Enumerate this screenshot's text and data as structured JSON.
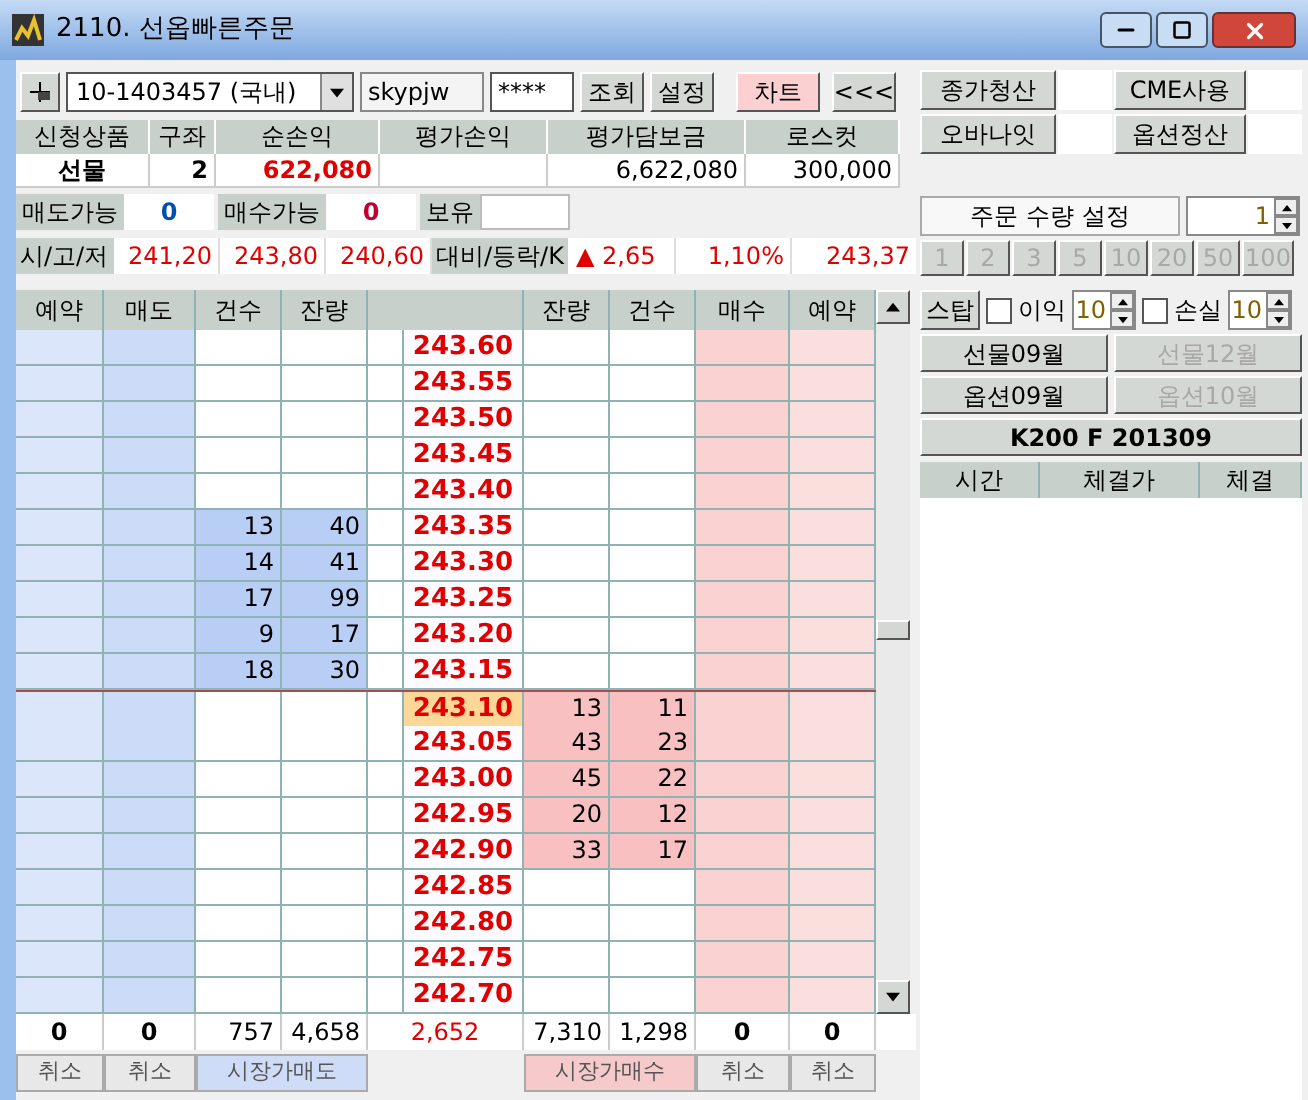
{
  "window": {
    "title": "2110. 선옵빠른주문"
  },
  "toolbar": {
    "account": "10-1403457 (국내)",
    "user_id": "skypjw",
    "password": "****",
    "buttons": [
      "조회",
      "설정"
    ],
    "chart_button": "차트",
    "collapse_button": "<<<"
  },
  "right_buttons": [
    {
      "label": "종가청산"
    },
    {
      "label": "CME사용"
    },
    {
      "label": "오바나잇"
    },
    {
      "label": "옵션정산"
    }
  ],
  "summary": [
    {
      "header": "신청상품",
      "value": "선물"
    },
    {
      "header": "구좌",
      "value": "2"
    },
    {
      "header": "순손익",
      "value": "622,080"
    },
    {
      "header": "평가손익"
    },
    {
      "header": "평가담보금",
      "value": "6,622,080"
    },
    {
      "header": "로스컷",
      "value": "300,000"
    }
  ],
  "availability": [
    {
      "label": "매도가능",
      "value": "0",
      "kind": "sell"
    },
    {
      "label": "매수가능",
      "value": "0",
      "kind": "buy"
    },
    {
      "label": "보유"
    }
  ],
  "quote": {
    "label": "시/고/저",
    "open": "241,20",
    "high": "243,80",
    "low": "240,60",
    "change_label": "대비/등락/K",
    "change": "▲ 2,65",
    "rate": "1,10%",
    "k": "243,37"
  },
  "order_qty": {
    "label": "주문 수량 설정",
    "value": "1",
    "presets": [
      {
        "label": "1",
        "disabled": true
      },
      {
        "label": "2",
        "disabled": true
      },
      {
        "label": "3",
        "disabled": true
      },
      {
        "label": "5",
        "disabled": true
      },
      {
        "label": "10",
        "disabled": true
      },
      {
        "label": "20",
        "disabled": true
      },
      {
        "label": "50",
        "disabled": true
      },
      {
        "label": "100",
        "disabled": true
      }
    ]
  },
  "stop": {
    "button": "스탑",
    "profit": {
      "label": "이익",
      "checked": false,
      "value": "10"
    },
    "loss": {
      "label": "손실",
      "checked": false,
      "value": "10"
    }
  },
  "contracts": [
    {
      "label": "선물09월",
      "disabled": false
    },
    {
      "label": "선물12월",
      "disabled": true
    },
    {
      "label": "옵션09월",
      "disabled": false
    },
    {
      "label": "옵션10월",
      "disabled": true
    }
  ],
  "symbol": "K200 F 201309",
  "trades": {
    "columns": [
      "시간",
      "체결가",
      "체결"
    ]
  },
  "orderbook": {
    "left_columns": [
      "예약",
      "매도",
      "건수",
      "잔량"
    ],
    "right_columns": [
      "잔량",
      "건수",
      "매수",
      "예약"
    ],
    "rows": [
      {
        "kind": "ask",
        "price": "243.60",
        "current": false
      },
      {
        "kind": "ask",
        "price": "243.55",
        "current": false
      },
      {
        "kind": "ask",
        "price": "243.50",
        "current": false
      },
      {
        "kind": "ask",
        "price": "243.45",
        "current": false
      },
      {
        "kind": "ask",
        "price": "243.40",
        "current": false
      },
      {
        "kind": "ask",
        "price": "243.35",
        "count": "13",
        "qty": "40",
        "current": false
      },
      {
        "kind": "ask",
        "price": "243.30",
        "count": "14",
        "qty": "41",
        "current": false
      },
      {
        "kind": "ask",
        "price": "243.25",
        "count": "17",
        "qty": "99",
        "current": false
      },
      {
        "kind": "ask",
        "price": "243.20",
        "count": "9",
        "qty": "17",
        "current": false
      },
      {
        "kind": "ask",
        "price": "243.15",
        "count": "18",
        "qty": "30",
        "current": false
      },
      {
        "kind": "bid",
        "price": "243.10",
        "qty": "13",
        "count": "11",
        "current": true
      },
      {
        "kind": "bid",
        "price": "243.05",
        "qty": "43",
        "count": "23",
        "current": false
      },
      {
        "kind": "bid",
        "price": "243.00",
        "qty": "45",
        "count": "22",
        "current": false
      },
      {
        "kind": "bid",
        "price": "242.95",
        "qty": "20",
        "count": "12",
        "current": false
      },
      {
        "kind": "bid",
        "price": "242.90",
        "qty": "33",
        "count": "17",
        "current": false
      },
      {
        "kind": "bid",
        "price": "242.85",
        "current": false
      },
      {
        "kind": "bid",
        "price": "242.80",
        "current": false
      },
      {
        "kind": "bid",
        "price": "242.75",
        "current": false
      },
      {
        "kind": "bid",
        "price": "242.70",
        "current": false
      }
    ],
    "totals": {
      "sell_reserve": "0",
      "sell": "0",
      "ask_count": "757",
      "ask_qty": "4,658",
      "diff": "2,652",
      "bid_qty": "7,310",
      "bid_count": "1,298",
      "buy": "0",
      "buy_reserve": "0"
    }
  },
  "bottom_buttons": [
    {
      "label": "취소",
      "kind": "cancel"
    },
    {
      "label": "취소",
      "kind": "cancel"
    },
    {
      "label": "시장가매도",
      "kind": "market_sell"
    },
    {
      "label": "시장가매수",
      "kind": "market_buy"
    },
    {
      "label": "취소",
      "kind": "cancel"
    },
    {
      "label": "취소",
      "kind": "cancel"
    }
  ]
}
